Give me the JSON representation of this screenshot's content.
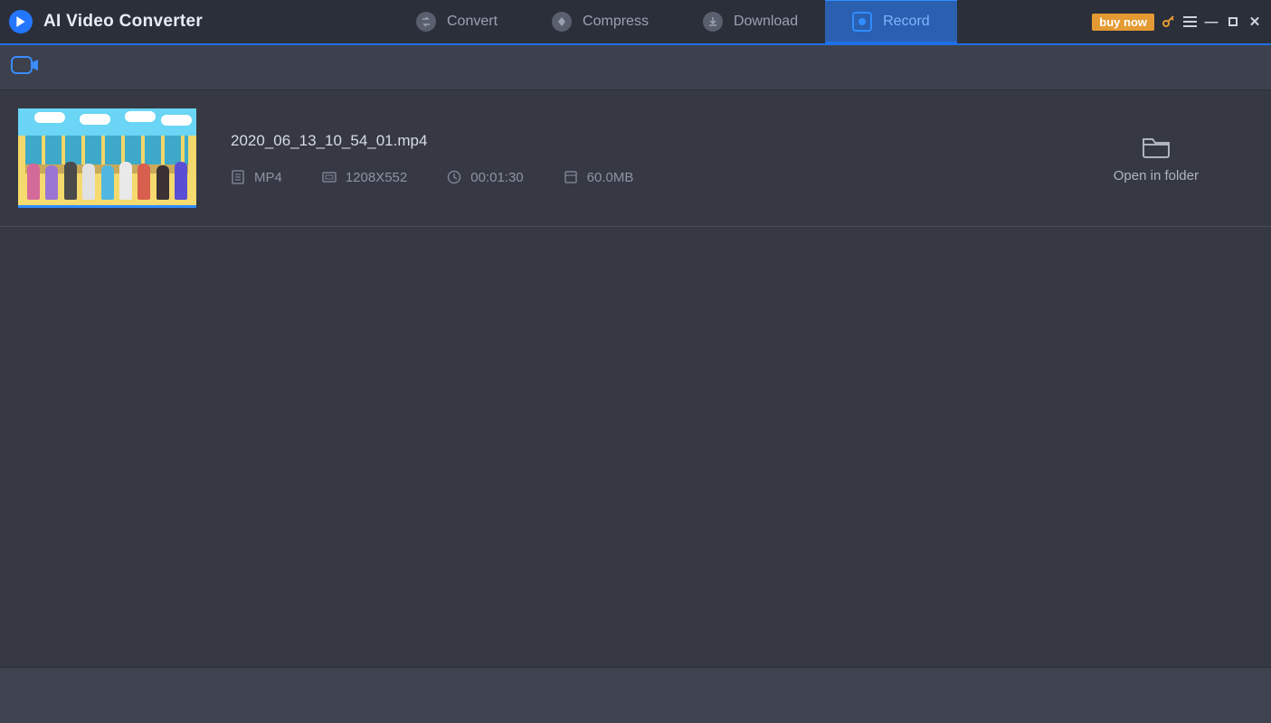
{
  "app": {
    "title": "AI Video Converter"
  },
  "nav": {
    "convert": "Convert",
    "compress": "Compress",
    "download": "Download",
    "record": "Record"
  },
  "window": {
    "buy_now": "buy now"
  },
  "file": {
    "name": "2020_06_13_10_54_01.mp4",
    "format": "MP4",
    "resolution": "1208X552",
    "duration": "00:01:30",
    "size": "60.0MB",
    "open_folder": "Open in folder"
  }
}
